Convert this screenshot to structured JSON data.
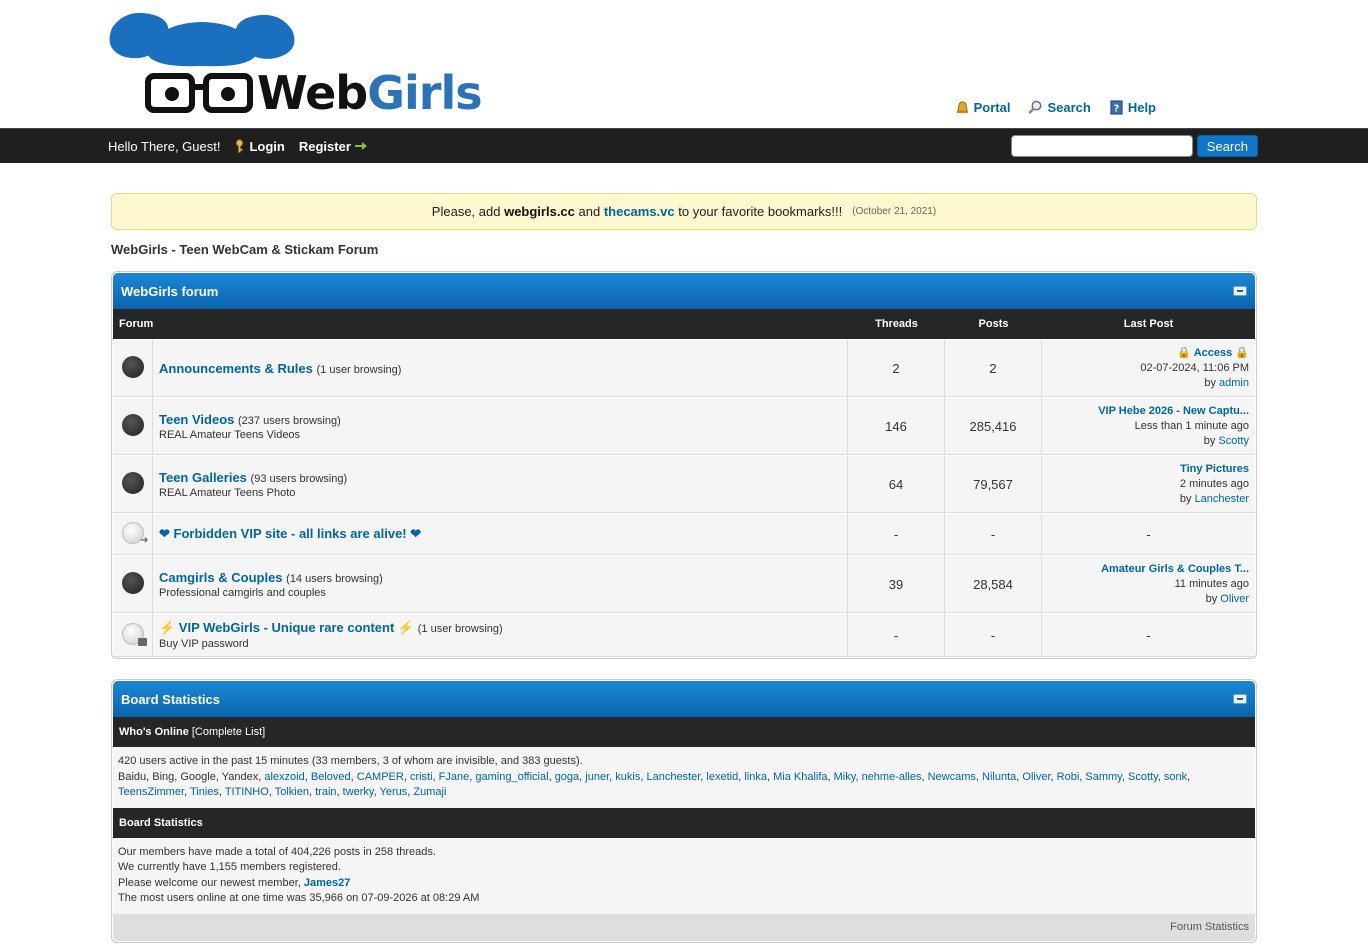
{
  "header": {
    "logo_word1": "Web",
    "logo_word2": "Girls",
    "links": [
      {
        "label": "Portal",
        "icon": "bell-icon"
      },
      {
        "label": "Search",
        "icon": "magnifier-icon"
      },
      {
        "label": "Help",
        "icon": "help-book-icon"
      }
    ]
  },
  "nav": {
    "greeting": "Hello There, Guest!",
    "login": "Login",
    "register": "Register",
    "search_button": "Search",
    "search_placeholder": ""
  },
  "announcement": {
    "prefix": "Please, add ",
    "site1": "webgirls.cc",
    "middle": " and ",
    "site2": "thecams.vc",
    "suffix": " to your favorite bookmarks!!!",
    "date": "(October 21, 2021)"
  },
  "board_title": "WebGirls - Teen WebCam & Stickam Forum",
  "forum_section": {
    "title": "WebGirls forum",
    "columns": {
      "forum": "Forum",
      "threads": "Threads",
      "posts": "Posts",
      "last_post": "Last Post"
    },
    "rows": [
      {
        "name": "Announcements & Rules",
        "browsing": "(1 user browsing)",
        "desc": "",
        "threads": "2",
        "posts": "2",
        "lp_title": "🔒 Access 🔒",
        "lp_time": "02-07-2024, 11:06 PM",
        "lp_by": "by ",
        "lp_user": "admin"
      },
      {
        "name": "Teen Videos",
        "browsing": "(237 users browsing)",
        "desc": "REAL Amateur Teens Videos",
        "threads": "146",
        "posts": "285,416",
        "lp_title": "VIP Hebe 2026 - New Captu...",
        "lp_time": "Less than 1 minute ago",
        "lp_by": "by ",
        "lp_user": "Scotty"
      },
      {
        "name": "Teen Galleries",
        "browsing": "(93 users browsing)",
        "desc": "REAL Amateur Teens Photo",
        "threads": "64",
        "posts": "79,567",
        "lp_title": "Tiny Pictures",
        "lp_time": "2 minutes ago",
        "lp_by": "by ",
        "lp_user": "Lanchester"
      },
      {
        "name": "❤ Forbidden VIP site - all links are alive! ❤",
        "browsing": "",
        "desc": "",
        "threads": "-",
        "posts": "-",
        "lp_dash": "-"
      },
      {
        "name": "Camgirls & Couples",
        "browsing": "(14 users browsing)",
        "desc": "Professional camgirls and couples",
        "threads": "39",
        "posts": "28,584",
        "lp_title": "Amateur Girls & Couples T...",
        "lp_time": "11 minutes ago",
        "lp_by": "by ",
        "lp_user": "Oliver"
      },
      {
        "name": "⚡ VIP WebGirls - Unique rare content ⚡",
        "browsing": "(1 user browsing)",
        "desc": "Buy VIP password",
        "threads": "-",
        "posts": "-",
        "lp_dash": "-"
      }
    ]
  },
  "stats": {
    "title": "Board Statistics",
    "whos_online": "Who's Online",
    "complete_list": "[Complete List]",
    "online_summary": "420 users active in the past 15 minutes (33 members, 3 of whom are invisible, and 383 guests).",
    "online_bots": "Baidu, Bing, Google, Yandex, ",
    "online_users": [
      "alexzoid",
      "Beloved",
      "CAMPER",
      "cristi",
      "FJane",
      "gaming_official",
      "goga",
      "juner",
      "kukis",
      "Lanchester",
      "lexetid",
      "linka",
      "Mia Khalifa",
      "Miky",
      "nehme-alles",
      "Newcams",
      "Nilunta",
      "Oliver",
      "Robi",
      "Sammy",
      "Scotty",
      "sonk",
      "TeensZimmer",
      "Tinies",
      "TITINHO",
      "Tolkien",
      "train",
      "twerky",
      "Yerus",
      "Zumaji"
    ],
    "subheader": "Board Statistics",
    "line1": "Our members have made a total of 404,226 posts in 258 threads.",
    "line2": "We currently have 1,155 members registered.",
    "line3_prefix": "Please welcome our newest member, ",
    "newest_member": "James27",
    "line4": "The most users online at one time was 35,966 on 07-09-2026 at 08:29 AM",
    "footer": "Forum Statistics"
  }
}
